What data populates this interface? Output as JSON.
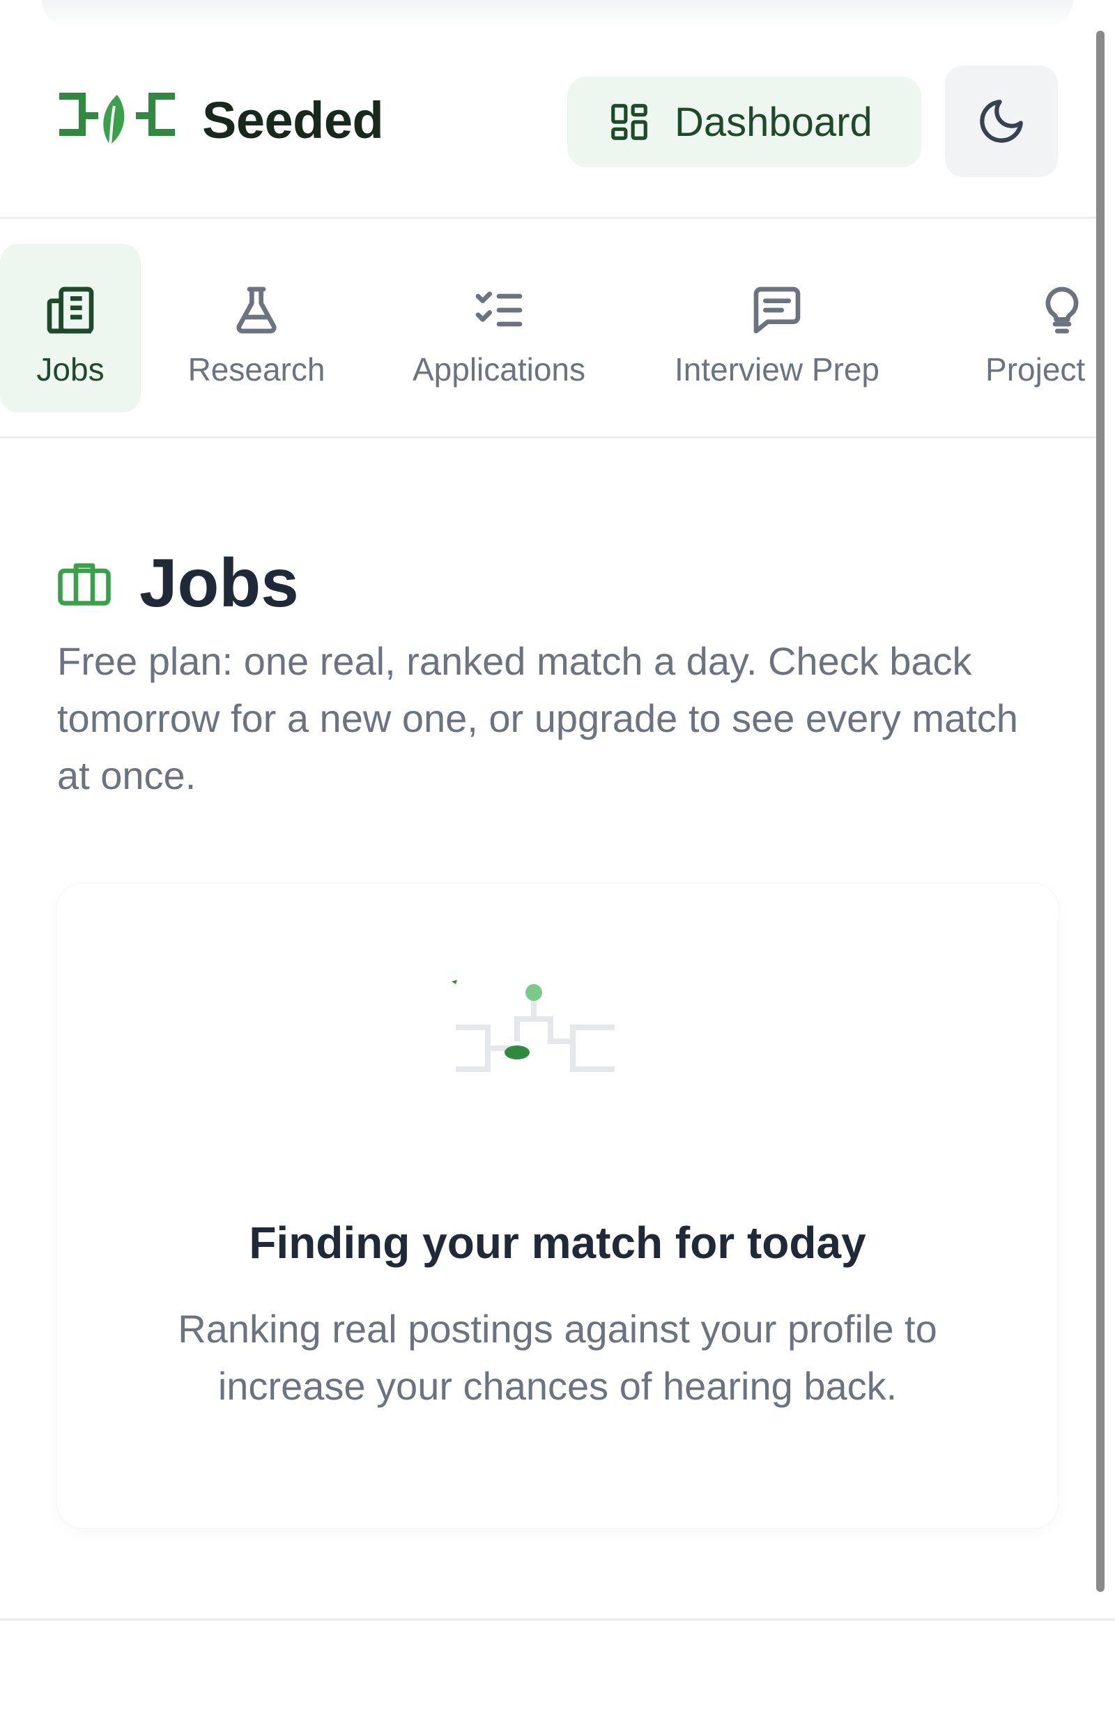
{
  "app": {
    "name": "Seeded",
    "accent_color": "#2f8a3f",
    "accent_light": "#eef7ef"
  },
  "header": {
    "dashboard_label": "Dashboard",
    "dashboard_icon": "grid-icon",
    "theme_icon": "moon-icon"
  },
  "nav": {
    "tabs": [
      {
        "label": "Jobs",
        "icon": "building-icon",
        "active": true
      },
      {
        "label": "Research",
        "icon": "flask-icon",
        "active": false
      },
      {
        "label": "Applications",
        "icon": "checklist-icon",
        "active": false
      },
      {
        "label": "Interview Prep",
        "icon": "message-icon",
        "active": false
      },
      {
        "label": "Project Ide",
        "icon": "lightbulb-icon",
        "active": false
      }
    ]
  },
  "main": {
    "title": "Jobs",
    "title_icon": "briefcase-icon",
    "subtitle": "Free plan: one real, ranked match a day. Check back tomorrow for a new one, or upgrade to see every match at once."
  },
  "status_card": {
    "title": "Finding your match for today",
    "description": "Ranking real postings against your profile to increase your chances of hearing back."
  }
}
